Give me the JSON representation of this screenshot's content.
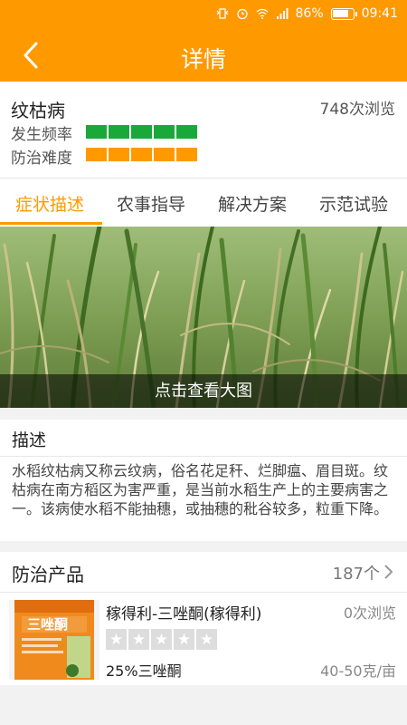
{
  "status_bar": {
    "battery": "86%",
    "time": "09:41"
  },
  "app_bar": {
    "title": "详情"
  },
  "disease": {
    "name": "纹枯病",
    "views": "748次浏览",
    "frequency_label": "发生频率",
    "difficulty_label": "防治难度",
    "frequency_level": 5,
    "difficulty_level": 5,
    "frequency_color": "#1ba83b",
    "difficulty_color": "#ff9900"
  },
  "tabs": [
    {
      "label": "症状描述",
      "active": true
    },
    {
      "label": "农事指导",
      "active": false
    },
    {
      "label": "解决方案",
      "active": false
    },
    {
      "label": "示范试验",
      "active": false
    }
  ],
  "hero": {
    "caption": "点击查看大图"
  },
  "description": {
    "title": "描述",
    "text": "水稻纹枯病又称云纹病，俗名花足秆、烂脚瘟、眉目斑。纹枯病在南方稻区为害严重，是当前水稻生产上的主要病害之一。该病使水稻不能抽穗，或抽穗的秕谷较多，粒重下降。"
  },
  "products": {
    "title": "防治产品",
    "count": "187个",
    "items": [
      {
        "name": "稼得利-三唑酮(稼得利)",
        "views": "0次浏览",
        "spec": "25%三唑酮",
        "dose": "40-50克/亩",
        "rating": 0,
        "package_text": "三唑酮"
      }
    ]
  },
  "colors": {
    "accent": "#ff9900"
  }
}
